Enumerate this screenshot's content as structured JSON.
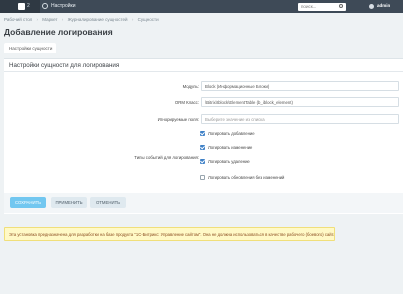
{
  "topbar": {
    "notifications_count": "2",
    "settings_label": "Настройки",
    "search_placeholder": "поиск...",
    "user_name": "admin"
  },
  "breadcrumb": {
    "items": [
      "Рабочий стол",
      "Маркет",
      "Журналирование сущностей",
      "Сущности"
    ]
  },
  "page": {
    "title": "Добавление логирования"
  },
  "tab": {
    "label": "Настройки сущности"
  },
  "panel": {
    "title": "Настройки сущности для логирования"
  },
  "form": {
    "module_label": "Модуль:",
    "module_value": "Block (Информационные Блоки)",
    "orm_label": "ORM Класс:",
    "orm_value": "\\Bitrix\\Iblock\\ElementTable (b_iblock_element)",
    "ignored_label": "Игнорируемые поля:",
    "ignored_placeholder": "Выберите значение из списка",
    "event_types_label": "Типы событий для логирования:",
    "events": [
      {
        "label": "Логировать добавление",
        "checked": true
      },
      {
        "label": "Логировать изменение",
        "checked": true
      },
      {
        "label": "Логировать удаление",
        "checked": true
      },
      {
        "label": "Логировать обновления без изменений",
        "checked": false
      }
    ]
  },
  "buttons": {
    "save": "СОХРАНИТЬ",
    "apply": "ПРИМЕНИТЬ",
    "cancel": "ОТМЕНИТЬ"
  },
  "warning": {
    "text": "Эта установка предназначена для разработки на базе продукта \"1С-Битрикс: Управление сайтом\". Она не должна использоваться в качестве рабочего (боевого) сайта."
  }
}
